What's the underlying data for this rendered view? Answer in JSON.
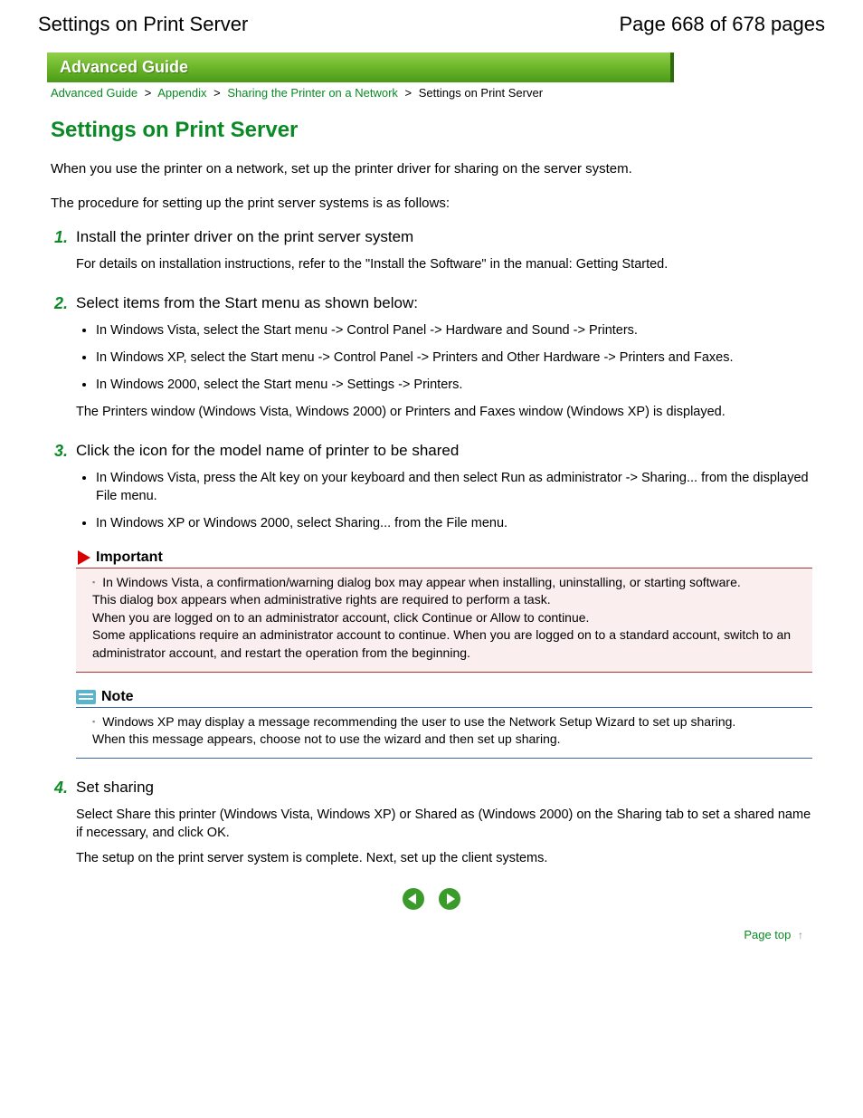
{
  "header": {
    "doc_title": "Settings on Print Server",
    "page_indicator": "Page 668 of 678 pages"
  },
  "banner": {
    "text": "Advanced Guide"
  },
  "breadcrumb": {
    "items": [
      "Advanced Guide",
      "Appendix",
      "Sharing the Printer on a Network"
    ],
    "current": "Settings on Print Server",
    "sep": ">"
  },
  "title": "Settings on Print Server",
  "intro": [
    "When you use the printer on a network, set up the printer driver for sharing on the server system.",
    "The procedure for setting up the print server systems is as follows:"
  ],
  "steps": [
    {
      "num": "1.",
      "title": "Install the printer driver on the print server system",
      "body": "For details on installation instructions, refer to the \"Install the Software\" in the manual: Getting Started."
    },
    {
      "num": "2.",
      "title": "Select items from the Start menu as shown below:",
      "bullets": [
        "In Windows Vista, select the Start menu -> Control Panel -> Hardware and Sound -> Printers.",
        "In Windows XP, select the Start menu -> Control Panel -> Printers and Other Hardware -> Printers and Faxes.",
        "In Windows 2000, select the Start menu -> Settings -> Printers."
      ],
      "after": "The Printers window (Windows Vista, Windows 2000) or Printers and Faxes window (Windows XP) is displayed."
    },
    {
      "num": "3.",
      "title": "Click the icon for the model name of printer to be shared",
      "bullets": [
        "In Windows Vista, press the Alt key on your keyboard and then select Run as administrator -> Sharing... from the displayed File menu.",
        "In Windows XP or Windows 2000, select Sharing... from the File menu."
      ],
      "important": {
        "label": "Important",
        "text": "In Windows Vista, a confirmation/warning dialog box may appear when installing, uninstalling, or starting software.\nThis dialog box appears when administrative rights are required to perform a task.\nWhen you are logged on to an administrator account, click Continue or Allow to continue.\nSome applications require an administrator account to continue. When you are logged on to a standard account, switch to an administrator account, and restart the operation from the beginning."
      },
      "note": {
        "label": "Note",
        "text": "Windows XP may display a message recommending the user to use the Network Setup Wizard to set up sharing.\nWhen this message appears, choose not to use the wizard and then set up sharing."
      }
    },
    {
      "num": "4.",
      "title": "Set sharing",
      "body": "Select Share this printer (Windows Vista, Windows XP) or Shared as (Windows 2000) on the Sharing tab to set a shared name if necessary, and click OK.",
      "after": "The setup on the print server system is complete. Next, set up the client systems."
    }
  ],
  "page_top": "Page top"
}
